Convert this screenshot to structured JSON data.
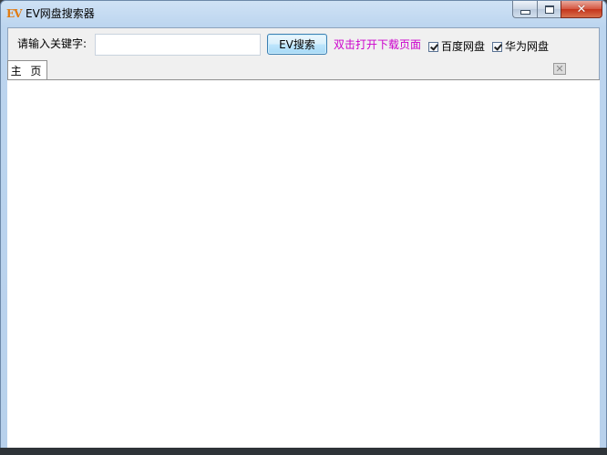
{
  "window": {
    "icon_text": "EV",
    "title": "EV网盘搜索器",
    "controls": {
      "minimize_icon": "minimize-icon",
      "maximize_icon": "maximize-icon",
      "close_icon": "close-icon",
      "close_glyph": "✕"
    }
  },
  "toolbar": {
    "keyword_label": "请输入关键字:",
    "keyword_value": "",
    "keyword_placeholder": "",
    "search_button": "EV搜索",
    "hint": "双击打开下载页面",
    "checkboxes": [
      {
        "label": "百度网盘",
        "checked": true
      },
      {
        "label": "华为网盘",
        "checked": true
      }
    ]
  },
  "tabs": [
    {
      "label": "主 页",
      "active": true
    }
  ],
  "tab_close_glyph": "✕",
  "colors": {
    "hint": "#cc00cc",
    "icon": "#e07a10",
    "close_button": "#c4341c"
  }
}
